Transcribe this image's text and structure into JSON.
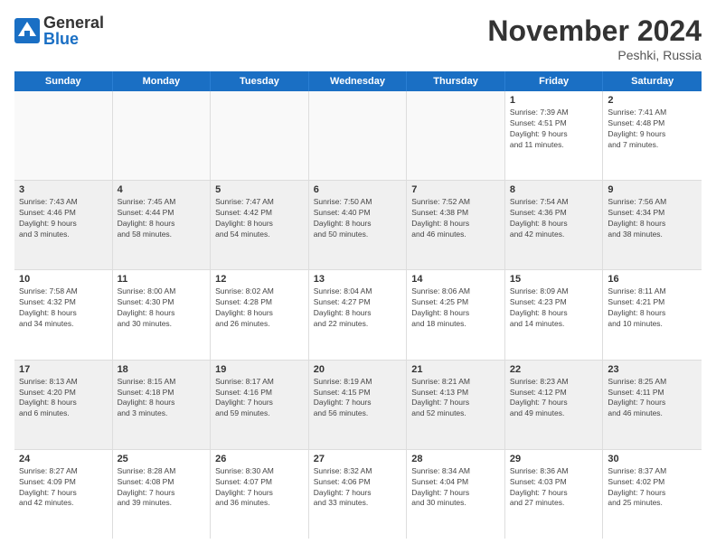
{
  "header": {
    "logo_general": "General",
    "logo_blue": "Blue",
    "month_title": "November 2024",
    "location": "Peshki, Russia"
  },
  "weekdays": [
    "Sunday",
    "Monday",
    "Tuesday",
    "Wednesday",
    "Thursday",
    "Friday",
    "Saturday"
  ],
  "rows": [
    [
      {
        "day": "",
        "detail": "",
        "empty": true
      },
      {
        "day": "",
        "detail": "",
        "empty": true
      },
      {
        "day": "",
        "detail": "",
        "empty": true
      },
      {
        "day": "",
        "detail": "",
        "empty": true
      },
      {
        "day": "",
        "detail": "",
        "empty": true
      },
      {
        "day": "1",
        "detail": "Sunrise: 7:39 AM\nSunset: 4:51 PM\nDaylight: 9 hours\nand 11 minutes."
      },
      {
        "day": "2",
        "detail": "Sunrise: 7:41 AM\nSunset: 4:48 PM\nDaylight: 9 hours\nand 7 minutes."
      }
    ],
    [
      {
        "day": "3",
        "detail": "Sunrise: 7:43 AM\nSunset: 4:46 PM\nDaylight: 9 hours\nand 3 minutes."
      },
      {
        "day": "4",
        "detail": "Sunrise: 7:45 AM\nSunset: 4:44 PM\nDaylight: 8 hours\nand 58 minutes."
      },
      {
        "day": "5",
        "detail": "Sunrise: 7:47 AM\nSunset: 4:42 PM\nDaylight: 8 hours\nand 54 minutes."
      },
      {
        "day": "6",
        "detail": "Sunrise: 7:50 AM\nSunset: 4:40 PM\nDaylight: 8 hours\nand 50 minutes."
      },
      {
        "day": "7",
        "detail": "Sunrise: 7:52 AM\nSunset: 4:38 PM\nDaylight: 8 hours\nand 46 minutes."
      },
      {
        "day": "8",
        "detail": "Sunrise: 7:54 AM\nSunset: 4:36 PM\nDaylight: 8 hours\nand 42 minutes."
      },
      {
        "day": "9",
        "detail": "Sunrise: 7:56 AM\nSunset: 4:34 PM\nDaylight: 8 hours\nand 38 minutes."
      }
    ],
    [
      {
        "day": "10",
        "detail": "Sunrise: 7:58 AM\nSunset: 4:32 PM\nDaylight: 8 hours\nand 34 minutes."
      },
      {
        "day": "11",
        "detail": "Sunrise: 8:00 AM\nSunset: 4:30 PM\nDaylight: 8 hours\nand 30 minutes."
      },
      {
        "day": "12",
        "detail": "Sunrise: 8:02 AM\nSunset: 4:28 PM\nDaylight: 8 hours\nand 26 minutes."
      },
      {
        "day": "13",
        "detail": "Sunrise: 8:04 AM\nSunset: 4:27 PM\nDaylight: 8 hours\nand 22 minutes."
      },
      {
        "day": "14",
        "detail": "Sunrise: 8:06 AM\nSunset: 4:25 PM\nDaylight: 8 hours\nand 18 minutes."
      },
      {
        "day": "15",
        "detail": "Sunrise: 8:09 AM\nSunset: 4:23 PM\nDaylight: 8 hours\nand 14 minutes."
      },
      {
        "day": "16",
        "detail": "Sunrise: 8:11 AM\nSunset: 4:21 PM\nDaylight: 8 hours\nand 10 minutes."
      }
    ],
    [
      {
        "day": "17",
        "detail": "Sunrise: 8:13 AM\nSunset: 4:20 PM\nDaylight: 8 hours\nand 6 minutes."
      },
      {
        "day": "18",
        "detail": "Sunrise: 8:15 AM\nSunset: 4:18 PM\nDaylight: 8 hours\nand 3 minutes."
      },
      {
        "day": "19",
        "detail": "Sunrise: 8:17 AM\nSunset: 4:16 PM\nDaylight: 7 hours\nand 59 minutes."
      },
      {
        "day": "20",
        "detail": "Sunrise: 8:19 AM\nSunset: 4:15 PM\nDaylight: 7 hours\nand 56 minutes."
      },
      {
        "day": "21",
        "detail": "Sunrise: 8:21 AM\nSunset: 4:13 PM\nDaylight: 7 hours\nand 52 minutes."
      },
      {
        "day": "22",
        "detail": "Sunrise: 8:23 AM\nSunset: 4:12 PM\nDaylight: 7 hours\nand 49 minutes."
      },
      {
        "day": "23",
        "detail": "Sunrise: 8:25 AM\nSunset: 4:11 PM\nDaylight: 7 hours\nand 46 minutes."
      }
    ],
    [
      {
        "day": "24",
        "detail": "Sunrise: 8:27 AM\nSunset: 4:09 PM\nDaylight: 7 hours\nand 42 minutes."
      },
      {
        "day": "25",
        "detail": "Sunrise: 8:28 AM\nSunset: 4:08 PM\nDaylight: 7 hours\nand 39 minutes."
      },
      {
        "day": "26",
        "detail": "Sunrise: 8:30 AM\nSunset: 4:07 PM\nDaylight: 7 hours\nand 36 minutes."
      },
      {
        "day": "27",
        "detail": "Sunrise: 8:32 AM\nSunset: 4:06 PM\nDaylight: 7 hours\nand 33 minutes."
      },
      {
        "day": "28",
        "detail": "Sunrise: 8:34 AM\nSunset: 4:04 PM\nDaylight: 7 hours\nand 30 minutes."
      },
      {
        "day": "29",
        "detail": "Sunrise: 8:36 AM\nSunset: 4:03 PM\nDaylight: 7 hours\nand 27 minutes."
      },
      {
        "day": "30",
        "detail": "Sunrise: 8:37 AM\nSunset: 4:02 PM\nDaylight: 7 hours\nand 25 minutes."
      }
    ]
  ]
}
